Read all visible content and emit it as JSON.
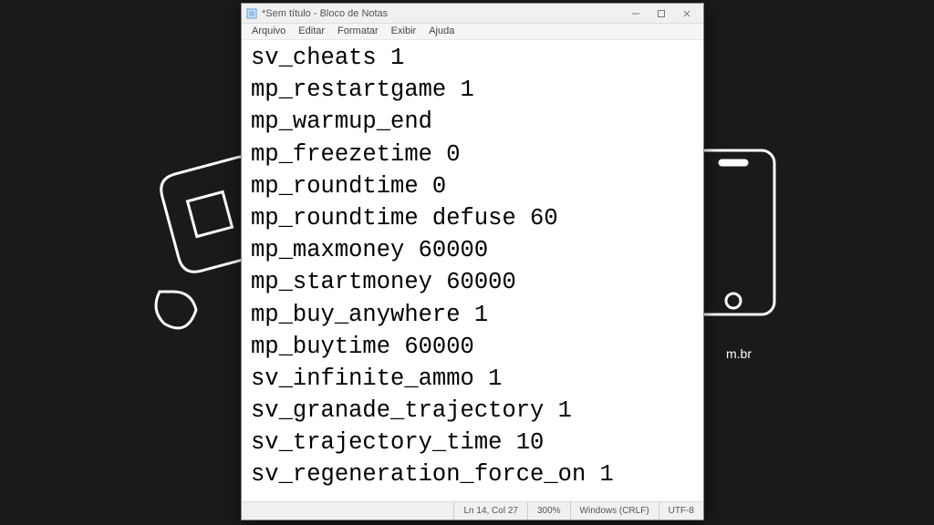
{
  "window": {
    "title": "*Sem título - Bloco de Notas"
  },
  "menu": {
    "file": "Arquivo",
    "edit": "Editar",
    "format": "Formatar",
    "view": "Exibir",
    "help": "Ajuda"
  },
  "editor": {
    "content": "sv_cheats 1\nmp_restartgame 1\nmp_warmup_end\nmp_freezetime 0\nmp_roundtime 0\nmp_roundtime defuse 60\nmp_maxmoney 60000\nmp_startmoney 60000\nmp_buy_anywhere 1\nmp_buytime 60000\nsv_infinite_ammo 1\nsv_granade_trajectory 1\nsv_trajectory_time 10\nsv_regeneration_force_on 1"
  },
  "status": {
    "position": "Ln 14, Col 27",
    "zoom": "300%",
    "lineending": "Windows (CRLF)",
    "encoding": "UTF-8"
  },
  "background": {
    "domain_fragment": "m.br"
  }
}
